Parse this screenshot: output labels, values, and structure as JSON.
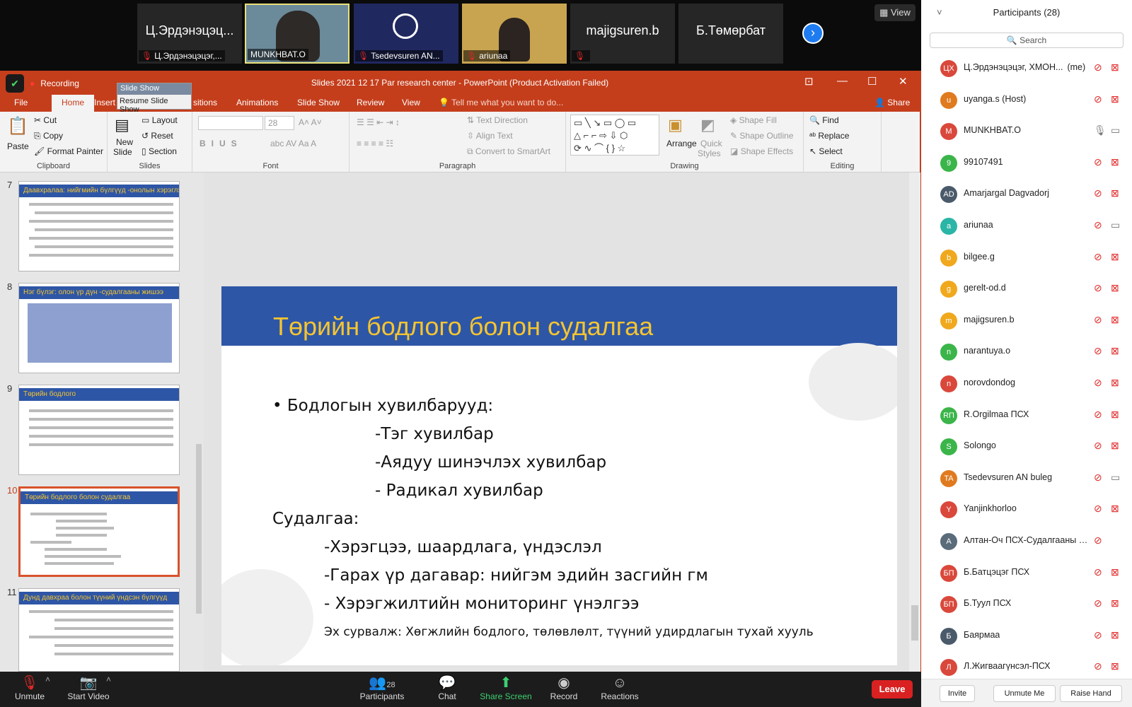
{
  "video_strip": {
    "tiles": [
      {
        "name": "Ц.Эрдэнэцэц...",
        "caption": "Ц.Эрдэнэцэцэг,...",
        "muted": true
      },
      {
        "name": "",
        "caption": "MUNKHBAT.O",
        "muted": false
      },
      {
        "name": "",
        "caption": "Tsedevsuren AN...",
        "muted": true
      },
      {
        "name": "",
        "caption": "ariunaa",
        "muted": true
      },
      {
        "name": "majigsuren.b",
        "caption": "",
        "muted": true
      },
      {
        "name": "Б.Төмөрбат",
        "caption": "",
        "muted": false
      }
    ],
    "view_label": "View"
  },
  "ppt": {
    "window_title": "Slides 2021 12 17 Par research center - PowerPoint (Product Activation Failed)",
    "recording_label": "Recording",
    "slideshow_menu": {
      "title": "Slide Show",
      "item": "Resume Slide Show"
    },
    "tabs": [
      "File",
      "Home",
      "Insert",
      "sitions",
      "Animations",
      "Slide Show",
      "Review",
      "View"
    ],
    "tell_me": "Tell me what you want to do...",
    "share": "Share",
    "ribbon": {
      "clipboard": {
        "paste": "Paste",
        "cut": "Cut",
        "copy": "Copy",
        "format_painter": "Format Painter",
        "label": "Clipboard"
      },
      "slides": {
        "new_slide": "New",
        "new_slide2": "Slide",
        "layout": "Layout",
        "reset": "Reset",
        "section": "Section",
        "label": "Slides"
      },
      "font": {
        "size": "28",
        "label": "Font"
      },
      "paragraph": {
        "text_direction": "Text Direction",
        "align_text": "Align Text",
        "convert": "Convert to SmartArt",
        "label": "Paragraph"
      },
      "drawing": {
        "arrange": "Arrange",
        "quick": "Quick",
        "styles": "Styles",
        "fill": "Shape Fill",
        "outline": "Shape Outline",
        "effects": "Shape Effects",
        "label": "Drawing"
      },
      "editing": {
        "find": "Find",
        "replace": "Replace",
        "select": "Select",
        "label": "Editing"
      }
    },
    "thumbnails": [
      {
        "num": "7",
        "title": "Даавхралаа: нийгмийн бүлгүүд -онолын хэрэглээ"
      },
      {
        "num": "8",
        "title": "Нэг бүлэг: олон үр дүн -судалгааны жишээ"
      },
      {
        "num": "9",
        "title": "Төрийн бодлого"
      },
      {
        "num": "10",
        "title": "Төрийн бодлого болон судалгаа"
      },
      {
        "num": "11",
        "title": "Дунд давхраа болон түүний үндсэн бүлгүүд"
      }
    ],
    "slide": {
      "title": "Төрийн бодлого болон судалгаа",
      "lines": [
        "• Бодлогын хувилбарууд:",
        "-Тэг хувилбар",
        "-Аядуу шинэчлэх хувилбар",
        "- Радикал хувилбар",
        "Судалгаа:",
        "-Хэрэгцээ, шаардлага, үндэслэл",
        "-Гарах үр дагавар: нийгэм эдийн засгийн гм",
        "- Хэрэгжилтийн мониторинг үнэлгээ"
      ],
      "source": "Эх сурвалж: Хөгжлийн бодлого, төлөвлөлт, түүний удирдлагын тухай хууль"
    }
  },
  "toolbar": {
    "unmute": "Unmute",
    "start_video": "Start Video",
    "participants": "Participants",
    "participants_count": "28",
    "chat": "Chat",
    "share_screen": "Share Screen",
    "record": "Record",
    "reactions": "Reactions",
    "leave": "Leave"
  },
  "participants": {
    "header": "Participants (28)",
    "search": "Search",
    "list": [
      {
        "initials": "ЦХ",
        "name": "Ц.Эрдэнэцэцэг, ХМОН...",
        "suffix": "(me)",
        "color": "#d9483b",
        "mic": "muted",
        "cam": "off"
      },
      {
        "initials": "u",
        "name": "uyanga.s (Host)",
        "suffix": "",
        "color": "#e07a1f",
        "mic": "muted",
        "cam": "off"
      },
      {
        "initials": "M",
        "name": "MUNKHBAT.O",
        "suffix": "",
        "color": "#d9483b",
        "mic": "on",
        "cam": "on"
      },
      {
        "initials": "9",
        "name": "99107491",
        "suffix": "",
        "color": "#3bb54a",
        "mic": "muted",
        "cam": "off"
      },
      {
        "initials": "AD",
        "name": "Amarjargal Dagvadorj",
        "suffix": "",
        "color": "#4a5a6a",
        "mic": "muted",
        "cam": "off"
      },
      {
        "initials": "a",
        "name": "ariunaa",
        "suffix": "",
        "color": "#2bb5a6",
        "mic": "muted",
        "cam": "on"
      },
      {
        "initials": "b",
        "name": "bilgee.g",
        "suffix": "",
        "color": "#f0a81d",
        "mic": "muted",
        "cam": "off"
      },
      {
        "initials": "g",
        "name": "gerelt-od.d",
        "suffix": "",
        "color": "#f0a81d",
        "mic": "muted",
        "cam": "off"
      },
      {
        "initials": "m",
        "name": "majigsuren.b",
        "suffix": "",
        "color": "#f0a81d",
        "mic": "muted",
        "cam": "off"
      },
      {
        "initials": "n",
        "name": "narantuya.o",
        "suffix": "",
        "color": "#3bb54a",
        "mic": "muted",
        "cam": "off"
      },
      {
        "initials": "n",
        "name": "norovdondog",
        "suffix": "",
        "color": "#d9483b",
        "mic": "muted",
        "cam": "off"
      },
      {
        "initials": "RП",
        "name": "R.Orgilmaa ПСХ",
        "suffix": "",
        "color": "#3bb54a",
        "mic": "muted",
        "cam": "off"
      },
      {
        "initials": "S",
        "name": "Solongo",
        "suffix": "",
        "color": "#3bb54a",
        "mic": "muted",
        "cam": "off"
      },
      {
        "initials": "TA",
        "name": "Tsedevsuren AN buleg",
        "suffix": "",
        "color": "#e07a1f",
        "mic": "muted",
        "cam": "on"
      },
      {
        "initials": "Y",
        "name": "Yanjinkhorloo",
        "suffix": "",
        "color": "#d9483b",
        "mic": "muted",
        "cam": "off"
      },
      {
        "initials": "А",
        "name": "Алтан-Оч ПСХ-Судалгааны алб...",
        "suffix": "",
        "color": "#5a6b7a",
        "mic": "muted",
        "cam": "none"
      },
      {
        "initials": "БП",
        "name": "Б.Батцэцэг ПСХ",
        "suffix": "",
        "color": "#d9483b",
        "mic": "muted",
        "cam": "off"
      },
      {
        "initials": "БП",
        "name": "Б.Туул ПСХ",
        "suffix": "",
        "color": "#d9483b",
        "mic": "muted",
        "cam": "off"
      },
      {
        "initials": "Б",
        "name": "Баярмаа",
        "suffix": "",
        "color": "#4a5a6a",
        "mic": "muted",
        "cam": "off"
      },
      {
        "initials": "Л",
        "name": "Л.Жигваагүнсэл-ПСХ",
        "suffix": "",
        "color": "#d9483b",
        "mic": "muted",
        "cam": "off"
      }
    ],
    "invite": "Invite",
    "unmute_me": "Unmute Me",
    "raise_hand": "Raise Hand"
  }
}
